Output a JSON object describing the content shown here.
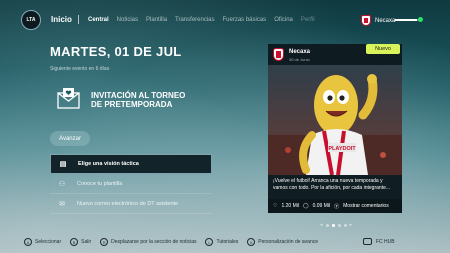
{
  "header": {
    "logo_text": "LTA",
    "home_label": "Inicio",
    "tabs": [
      {
        "label": "Central",
        "state": "active"
      },
      {
        "label": "Noticias",
        "state": "normal"
      },
      {
        "label": "Plantilla",
        "state": "normal"
      },
      {
        "label": "Transferencias",
        "state": "normal"
      },
      {
        "label": "Fuerzas básicas",
        "state": "normal"
      },
      {
        "label": "Oficina",
        "state": "normal"
      },
      {
        "label": "Perfil",
        "state": "dim"
      }
    ],
    "club_name": "Necaxa",
    "progress": 0.85
  },
  "main": {
    "date": "MARTES, 01 DE JUL",
    "next_event": "Siguiente evento en 6 días",
    "card_title_line1": "INVITACIÓN AL TORNEO",
    "card_title_line2": "DE PRETEMPORADA",
    "advance_label": "Avanzar",
    "list": [
      {
        "label": "Elige una visión táctica",
        "icon": "tactics-icon",
        "selected": true
      },
      {
        "label": "Conoce tu plantilla",
        "icon": "squad-icon",
        "selected": false
      },
      {
        "label": "Nuevo correo electrónico de DT asistente",
        "icon": "mail-icon",
        "selected": false
      }
    ]
  },
  "post": {
    "account": "Necaxa",
    "date": "30 de Junio",
    "badge": "Nuevo",
    "caption": "¡Vuelve el futbol! Arranca una nueva temporada y vamos con todo. Por la afición, por cada integrante...",
    "likes": "1.20 Mil",
    "comments": "0.09 Mil",
    "show_comments": "Mostrar comentarios"
  },
  "pager": {
    "pages": 4,
    "current": 1
  },
  "footer": {
    "items": [
      {
        "btn": "A",
        "label": "Seleccionar"
      },
      {
        "btn": "B",
        "label": "Salir"
      },
      {
        "btn": "R",
        "label": "Desplazarse por la sección de noticias"
      },
      {
        "btn": "L",
        "label": "Tutoriales"
      },
      {
        "btn": "X",
        "label": "Personalización de avance"
      }
    ],
    "hub_label": "FC HUB"
  },
  "colors": {
    "badge": "#d9f45a",
    "club_red": "#c8102e",
    "progress_dot": "#29e06c"
  }
}
